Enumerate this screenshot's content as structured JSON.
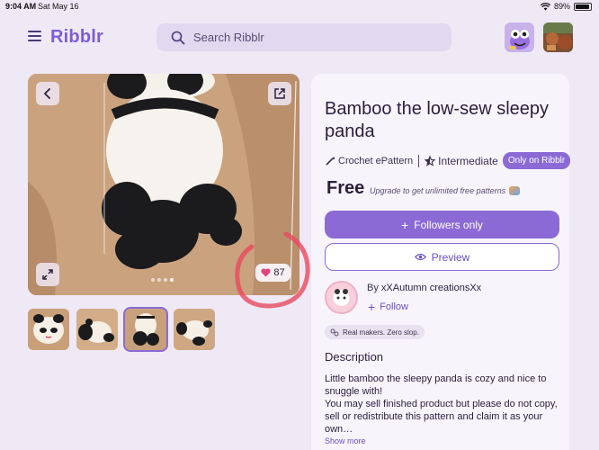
{
  "status_bar": {
    "time": "9:04 AM",
    "date": "Sat May 16",
    "battery": "89%"
  },
  "header": {
    "logo": "Ribblr",
    "search_placeholder": "Search Ribblr"
  },
  "gallery": {
    "likes": "87",
    "thumbnail_count": 4,
    "selected_thumbnail": 3,
    "image_dots": 4,
    "active_dot": 4
  },
  "product": {
    "title": "Bamboo the low-sew sleepy panda",
    "format": "Crochet ePattern",
    "level": "Intermediate",
    "exclusive_badge": "Only on Ribblr",
    "price": "Free",
    "upsell": "Upgrade to get unlimited free patterns",
    "primary_button": "Followers only",
    "secondary_button": "Preview"
  },
  "creator": {
    "by_label": "By",
    "name": "xXAutumn creationsXx",
    "follow_label": "Follow"
  },
  "tag": {
    "label": "Real makers. Zero slop."
  },
  "description": {
    "heading": "Description",
    "line1": "Little bamboo the sleepy panda is cozy and nice to snuggle with!",
    "line2": "You may sell finished product but please do not copy, sell or redistribute this pattern and claim it as your own…",
    "show_more": "Show more"
  },
  "colors": {
    "accent": "#8b6ad6",
    "background": "#efe9f6",
    "panel": "#f7f4fb",
    "annotation_circle": "#e8485f"
  }
}
